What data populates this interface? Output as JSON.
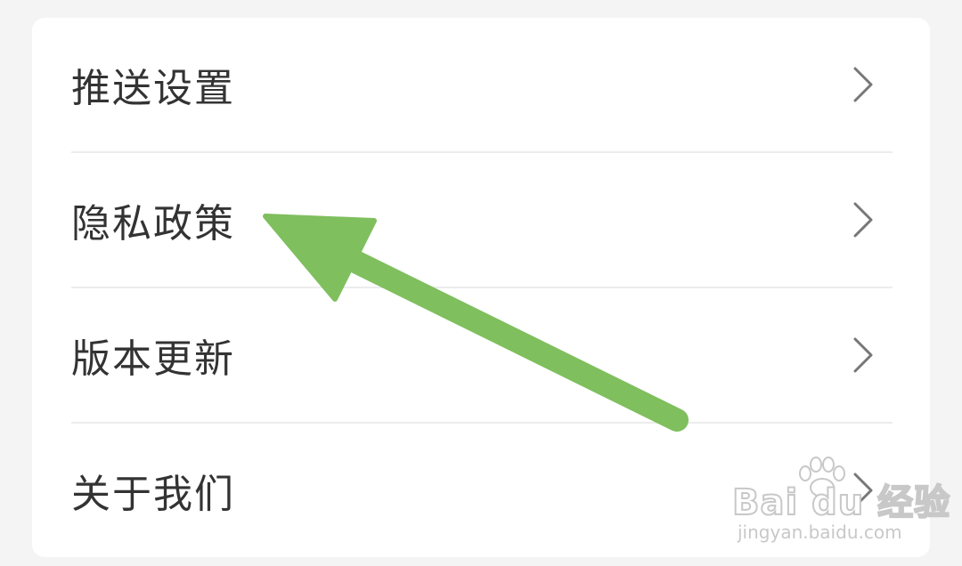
{
  "settings": {
    "items": [
      {
        "label": "推送设置",
        "icon": "chevron-right-icon"
      },
      {
        "label": "隐私政策",
        "icon": "chevron-right-icon"
      },
      {
        "label": "版本更新",
        "icon": "chevron-right-icon"
      },
      {
        "label": "关于我们",
        "icon": "chevron-right-icon"
      }
    ]
  },
  "annotation": {
    "arrow_color": "#7fbf5e",
    "points_to": "隐私政策"
  },
  "watermark": {
    "logo_text": "Bai du 经验",
    "url": "jingyan.baidu.com"
  },
  "colors": {
    "background": "#f4f4f4",
    "card": "#ffffff",
    "text": "#333333",
    "chevron": "#777777",
    "divider": "#ececec"
  }
}
